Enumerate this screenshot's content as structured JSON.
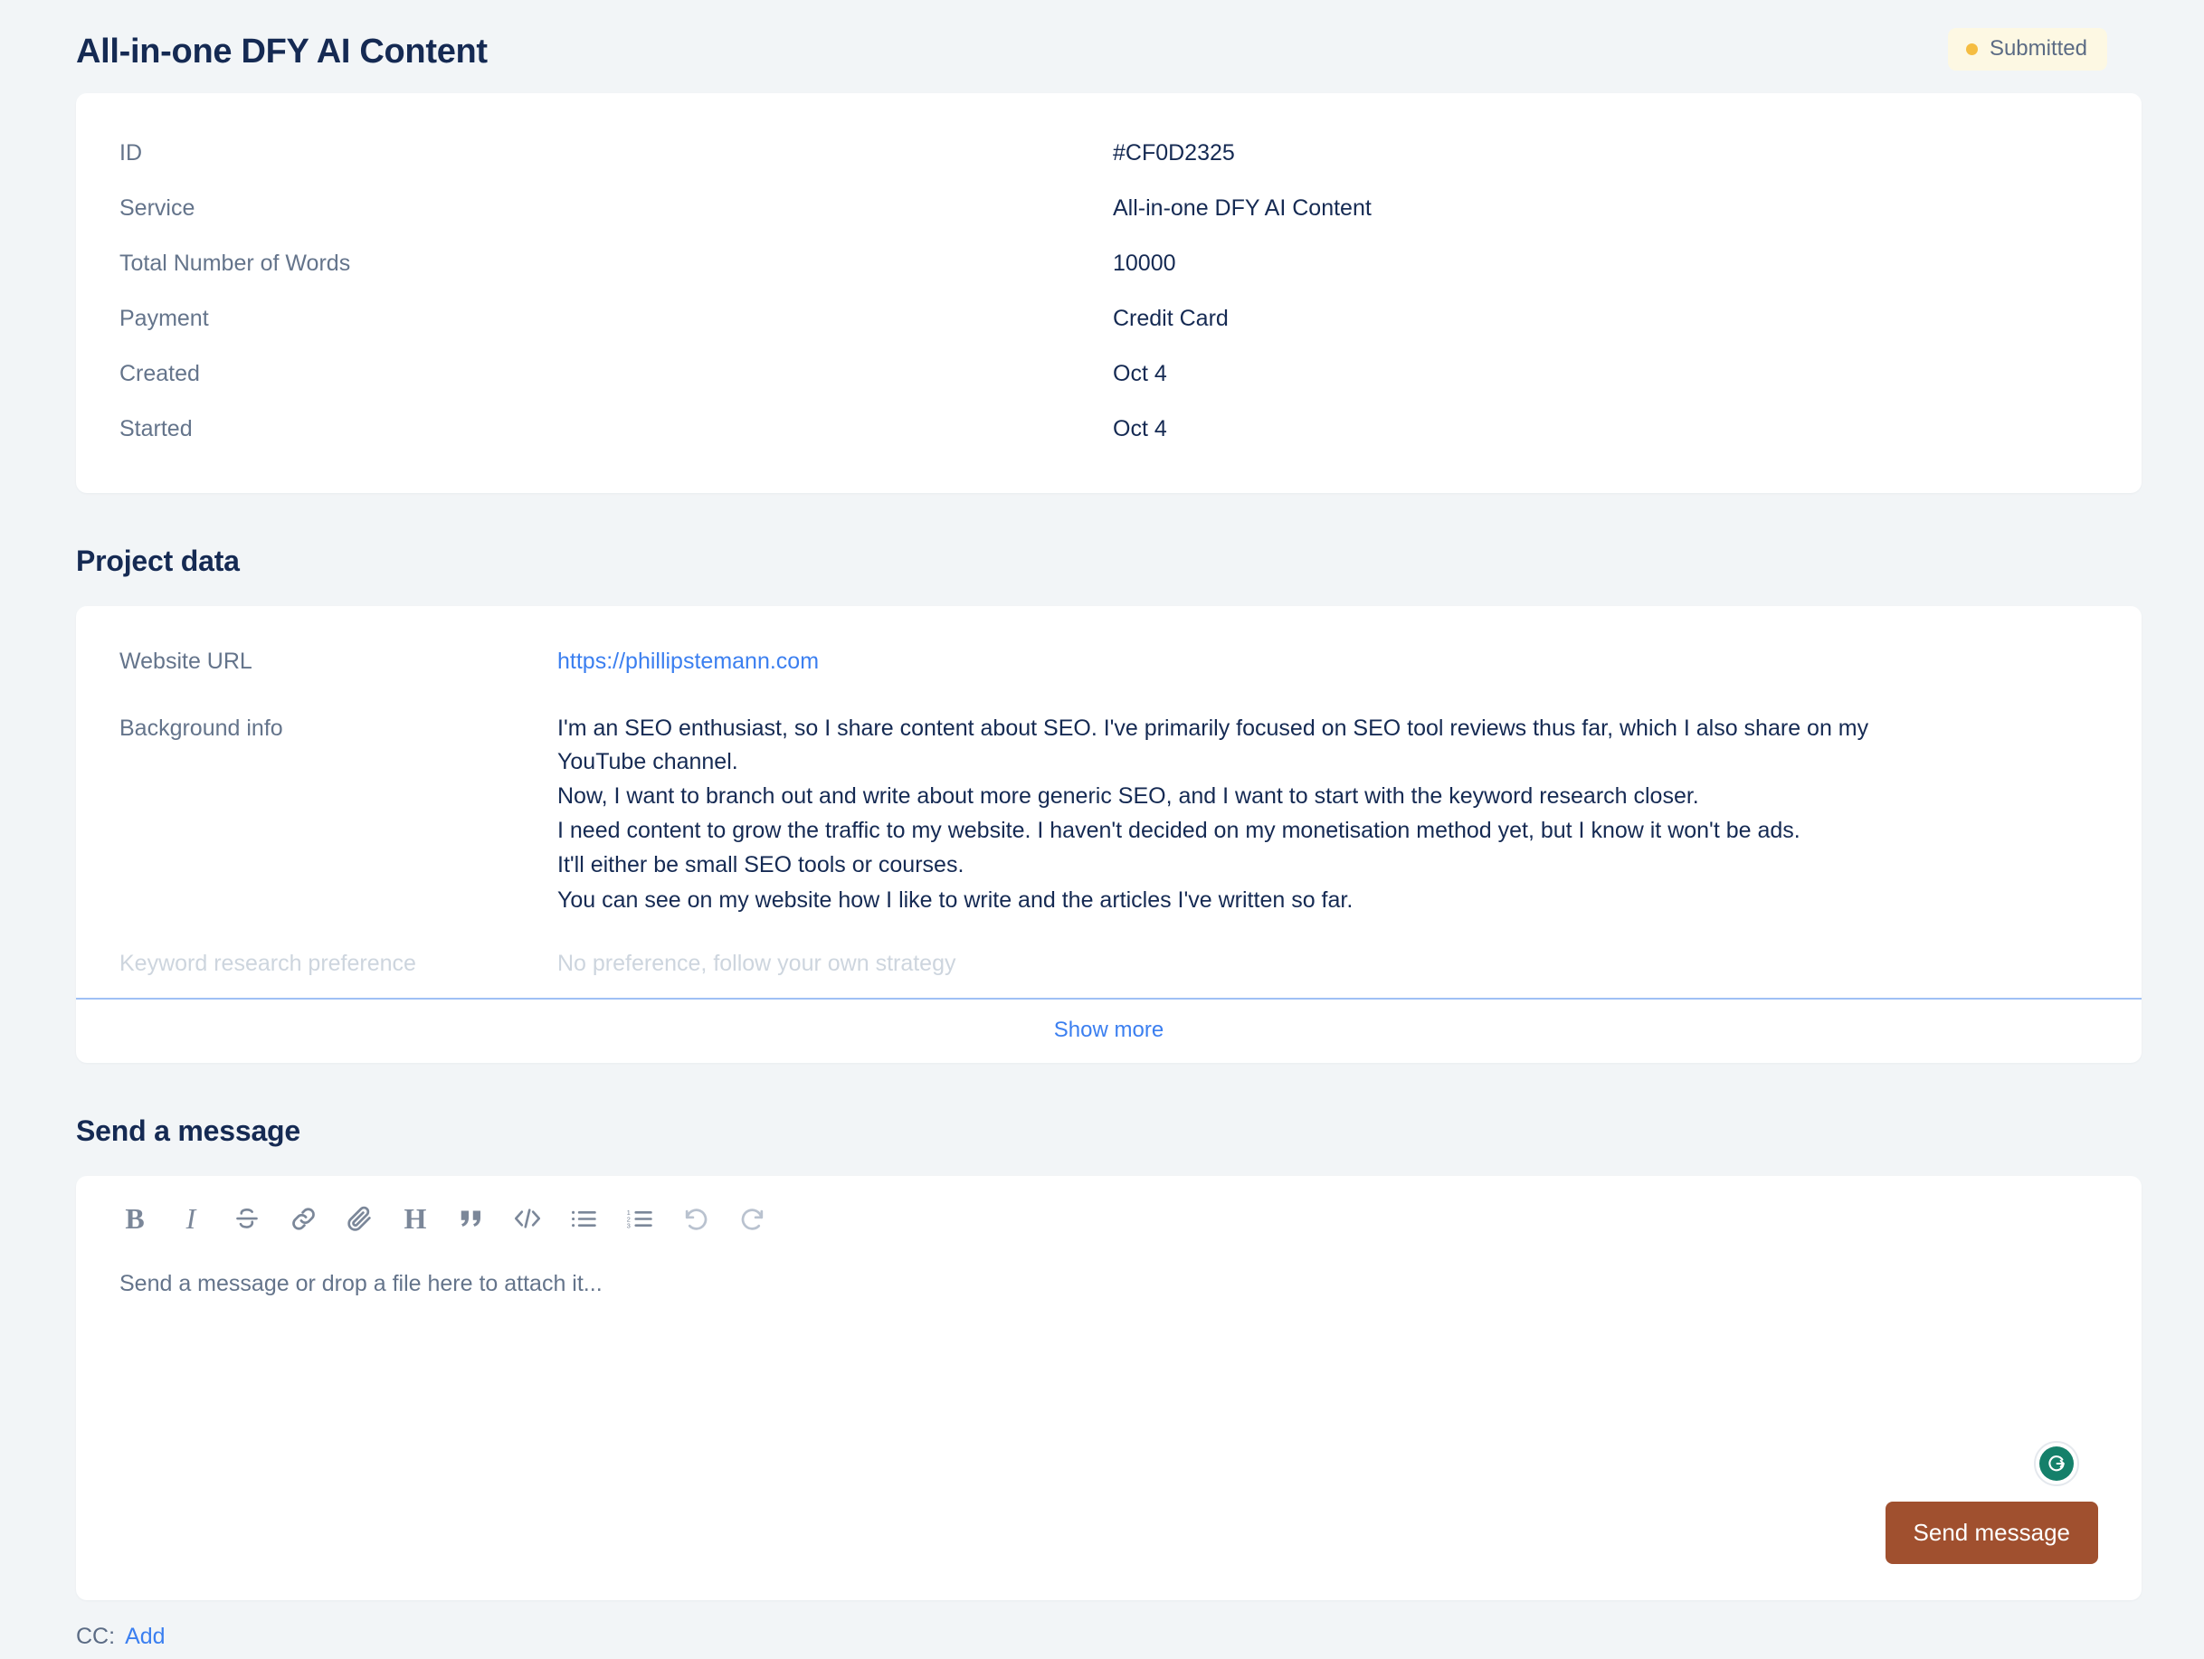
{
  "header": {
    "title": "All-in-one DFY AI Content",
    "status": {
      "label": "Submitted",
      "dot_color": "#f5bd42",
      "bg_color": "#fdf8e3"
    }
  },
  "details": {
    "rows": [
      {
        "label": "ID",
        "value": "#CF0D2325"
      },
      {
        "label": "Service",
        "value": "All-in-one DFY AI Content"
      },
      {
        "label": "Total Number of Words",
        "value": "10000"
      },
      {
        "label": "Payment",
        "value": "Credit Card"
      },
      {
        "label": "Created",
        "value": "Oct 4"
      },
      {
        "label": "Started",
        "value": "Oct 4"
      }
    ]
  },
  "project_data": {
    "heading": "Project data",
    "website_url_label": "Website URL",
    "website_url_value": "https://phillipstemann.com",
    "background_label": "Background info",
    "background_lines": [
      "I'm an SEO enthusiast, so I share content about SEO. I've primarily focused on SEO tool reviews thus far, which I also share on my YouTube channel.",
      "Now, I want to branch out and write about more generic SEO, and I want to start with the keyword research closer.",
      "I need content to grow the traffic to my website. I haven't decided on my monetisation method yet, but I know it won't be ads.",
      "It'll either be small SEO tools or courses.",
      "You can see on my website how I like to write and the articles I've written so far."
    ],
    "keyword_pref_label": "Keyword research preference",
    "keyword_pref_value": "No preference, follow your own strategy",
    "show_more_label": "Show more"
  },
  "message": {
    "heading": "Send a message",
    "toolbar": [
      {
        "name": "bold-icon",
        "label": "B"
      },
      {
        "name": "italic-icon",
        "label": "I"
      },
      {
        "name": "strikethrough-icon",
        "label": "S"
      },
      {
        "name": "link-icon",
        "label": "Link"
      },
      {
        "name": "attachment-icon",
        "label": "Attach"
      },
      {
        "name": "heading-icon",
        "label": "H"
      },
      {
        "name": "quote-icon",
        "label": "Quote"
      },
      {
        "name": "code-icon",
        "label": "Code"
      },
      {
        "name": "bullet-list-icon",
        "label": "Bullet list"
      },
      {
        "name": "numbered-list-icon",
        "label": "Numbered list"
      },
      {
        "name": "undo-icon",
        "label": "Undo"
      },
      {
        "name": "redo-icon",
        "label": "Redo"
      }
    ],
    "placeholder": "Send a message or drop a file here to attach it...",
    "grammarly_label": "G",
    "send_label": "Send message",
    "send_color": "#a0502f"
  },
  "cc": {
    "label": "CC:",
    "add_label": "Add"
  }
}
